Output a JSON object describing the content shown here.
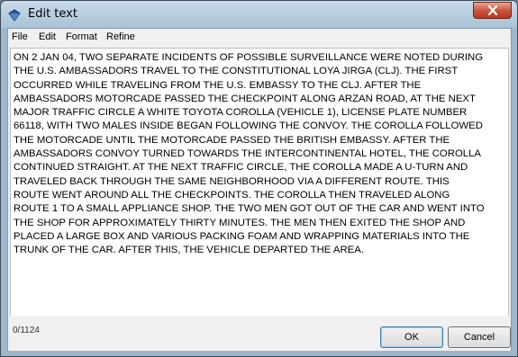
{
  "window": {
    "title": "Edit text",
    "close_icon": "close-icon",
    "app_icon": "diamond-icon"
  },
  "menu": {
    "items": [
      "File",
      "Edit",
      "Format",
      "Refine"
    ]
  },
  "editor": {
    "lines": [
      "ON 2 JAN 04, TWO SEPARATE INCIDENTS OF POSSIBLE SURVEILLANCE WERE NOTED DURING",
      "THE U.S. AMBASSADORS TRAVEL TO THE CONSTITUTIONAL LOYA JIRGA (CLJ).  THE FIRST",
      "OCCURRED WHILE TRAVELING FROM THE U.S. EMBASSY TO THE CLJ.  AFTER THE",
      "AMBASSADORS MOTORCADE PASSED THE CHECKPOINT ALONG ARZAN ROAD, AT THE NEXT",
      "MAJOR TRAFFIC CIRCLE A WHITE TOYOTA COROLLA (VEHICLE 1), LICENSE PLATE NUMBER",
      "66118, WITH TWO MALES INSIDE BEGAN FOLLOWING THE CONVOY.  THE COROLLA FOLLOWED",
      "THE MOTORCADE UNTIL THE MOTORCADE PASSED THE BRITISH EMBASSY.  AFTER THE",
      "AMBASSADORS CONVOY TURNED TOWARDS THE INTERCONTINENTAL HOTEL, THE COROLLA",
      "CONTINUED STRAIGHT.  AT THE NEXT TRAFFIC CIRCLE, THE COROLLA MADE A U-TURN AND",
      "TRAVELED BACK THROUGH THE SAME NEIGHBORHOOD VIA A DIFFERENT ROUTE.  THIS",
      "ROUTE WENT AROUND ALL THE CHECKPOINTS.  THE COROLLA THEN TRAVELED ALONG",
      "ROUTE 1 TO A SMALL APPLIANCE SHOP. THE TWO MEN GOT OUT OF THE CAR AND WENT INTO",
      "THE SHOP FOR APPROXIMATELY THIRTY MINUTES.  THE MEN THEN EXITED THE SHOP AND",
      "PLACED A LARGE BOX AND VARIOUS PACKING FOAM AND WRAPPING MATERIALS INTO THE",
      "TRUNK OF THE CAR.  AFTER THIS, THE VEHICLE DEPARTED THE AREA."
    ]
  },
  "footer": {
    "char_count": "0/1124",
    "ok_label": "OK",
    "cancel_label": "Cancel"
  },
  "colors": {
    "titlebar": "#b9cfe2",
    "close_button": "#c9503a",
    "ok_border": "#3c7fb1"
  }
}
